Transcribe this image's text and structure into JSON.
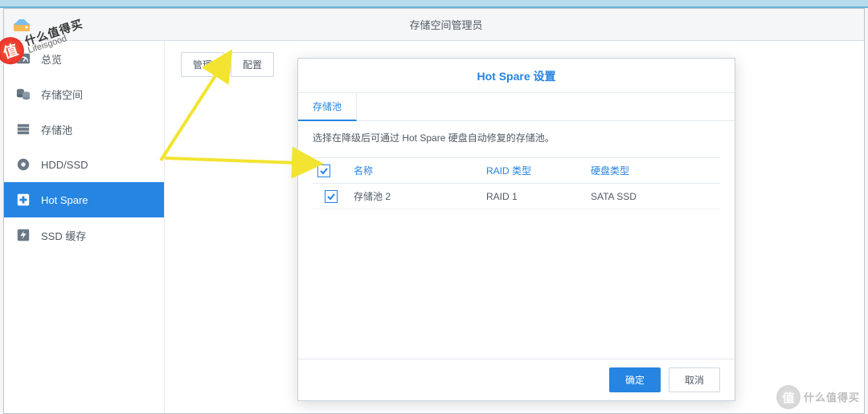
{
  "taskbar": {
    "active": true
  },
  "window": {
    "title": "存储空间管理员"
  },
  "sidebar": {
    "items": [
      {
        "label": "总览",
        "icon": "gauge"
      },
      {
        "label": "存储空间",
        "icon": "cylinders"
      },
      {
        "label": "存储池",
        "icon": "bars"
      },
      {
        "label": "HDD/SSD",
        "icon": "disc"
      },
      {
        "label": "Hot Spare",
        "icon": "plus-box"
      },
      {
        "label": "SSD 缓存",
        "icon": "lightning"
      }
    ],
    "active_index": 4
  },
  "toolbar": {
    "manage_label": "管理",
    "configure_label": "配置"
  },
  "dialog": {
    "title": "Hot Spare 设置",
    "tab_label": "存储池",
    "instruction": "选择在降级后可通过 Hot Spare 硬盘自动修复的存储池。",
    "columns": {
      "name": "名称",
      "raid": "RAID 类型",
      "disk": "硬盘类型"
    },
    "header_checked": true,
    "rows": [
      {
        "checked": true,
        "name": "存储池 2",
        "raid": "RAID 1",
        "disk": "SATA SSD"
      }
    ],
    "ok_label": "确定",
    "cancel_label": "取消"
  },
  "watermark": {
    "char": "值",
    "cn": "什么值得买",
    "en": "Lifeisgood"
  }
}
